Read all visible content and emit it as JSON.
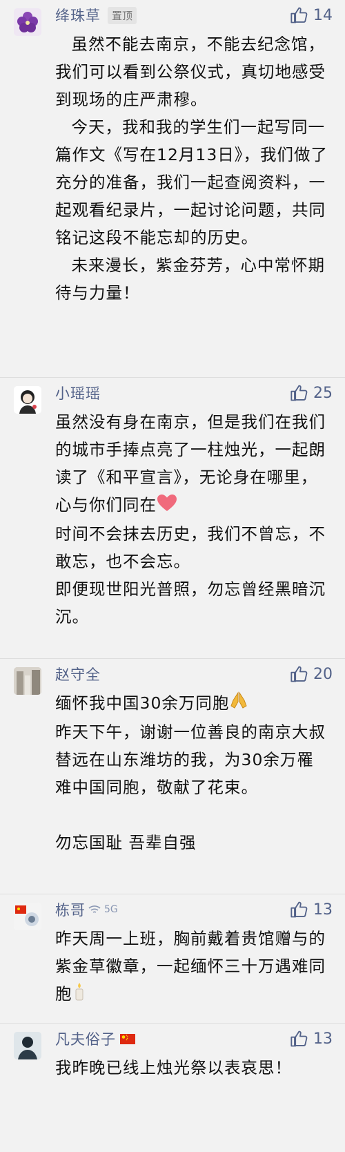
{
  "comments": [
    {
      "name": "绛珠草",
      "pin_label": "置顶",
      "likes": "14",
      "paragraphs": [
        "虽然不能去南京，不能去纪念馆，我们可以看到公祭仪式，真切地感受到现场的庄严肃穆。",
        "今天，我和我的学生们一起写同一篇作文《写在12月13日》，我们做了充分的准备，我们一起查阅资料，一起观看纪录片，一起讨论问题，共同铭记这段不能忘却的历史。",
        "未来漫长，紫金芬芳，心中常怀期待与力量！"
      ]
    },
    {
      "name": "小瑶瑶",
      "likes": "25",
      "paragraphs": [
        "虽然没有身在南京，但是我们在我们的城市手捧点亮了一柱烛光，一起朗读了《和平宣言》，无论身在哪里，心与你们同在",
        "时间不会抹去历史，我们不曾忘，不敢忘，也不会忘。",
        "即便现世阳光普照，勿忘曾经黑暗沉沉。"
      ],
      "emoji": "heart"
    },
    {
      "name": "赵守全",
      "likes": "20",
      "paragraphs": [
        "缅怀我中国30余万同胞",
        "昨天下午，谢谢一位善良的南京大叔",
        "替远在山东潍坊的我，为30余万罹难中国同胞，敬献了花束。",
        "",
        "勿忘国耻 吾辈自强"
      ],
      "emoji": "pray"
    },
    {
      "name": "栋哥",
      "network": "5G",
      "likes": "13",
      "paragraphs": [
        "昨天周一上班，胸前戴着贵馆赠与的紫金草徽章，一起缅怀三十万遇难同胞"
      ],
      "emoji": "candle"
    },
    {
      "name": "凡夫俗子",
      "likes": "13",
      "paragraphs": [
        "我昨晚已线上烛光祭以表哀思！"
      ]
    }
  ]
}
